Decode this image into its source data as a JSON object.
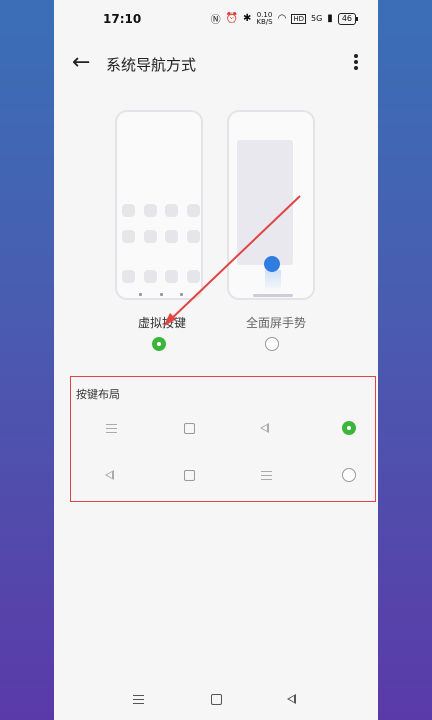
{
  "status_bar": {
    "time": "17:10",
    "net_speed_value": "0.10",
    "net_speed_unit": "KB/S",
    "battery": "46",
    "hd_label": "HD",
    "signal_label": "5G"
  },
  "app_bar": {
    "title": "系统导航方式",
    "back_icon": "arrow-left-icon",
    "more_icon": "more-vertical-icon"
  },
  "options": [
    {
      "label": "虚拟按键",
      "selected": true
    },
    {
      "label": "全面屏手势",
      "selected": false
    }
  ],
  "key_layout": {
    "title": "按键布局",
    "rows": [
      {
        "buttons": [
          "menu-icon",
          "square-icon",
          "back-triangle-icon"
        ],
        "selected": true
      },
      {
        "buttons": [
          "back-triangle-icon",
          "square-icon",
          "menu-icon"
        ],
        "selected": false
      }
    ]
  },
  "colors": {
    "accent_green": "#3db53d",
    "annotation_red": "#e04444",
    "gesture_blue": "#2f7de1"
  }
}
